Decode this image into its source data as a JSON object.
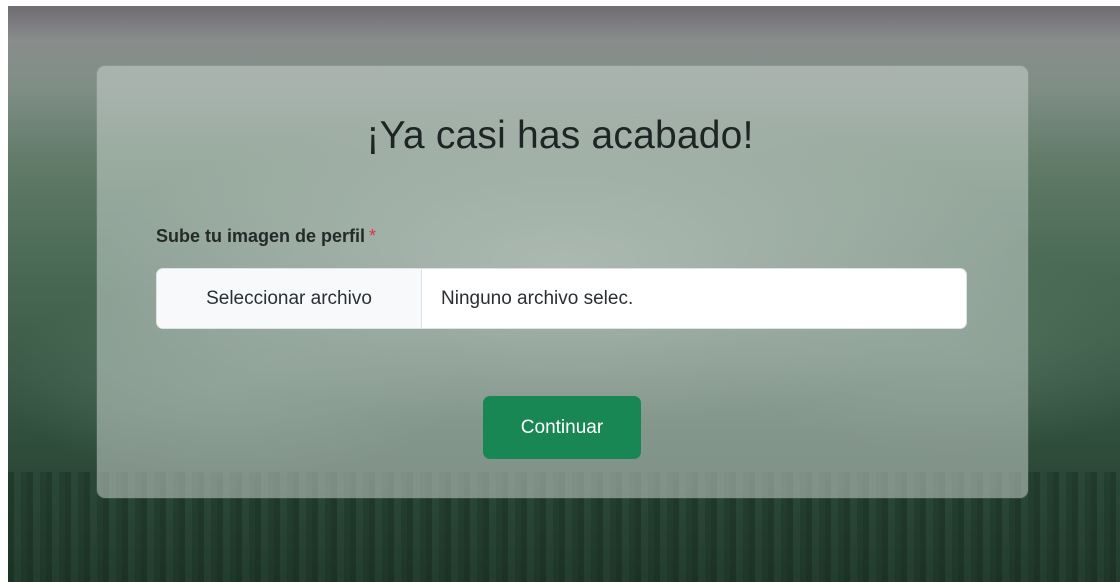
{
  "card": {
    "title": "¡Ya casi has acabado!"
  },
  "upload": {
    "label": "Sube tu imagen de perfil",
    "required_marker": "*",
    "button_label": "Seleccionar archivo",
    "status_text": "Ninguno archivo selec."
  },
  "actions": {
    "continue_label": "Continuar"
  },
  "colors": {
    "primary_button": "#198754",
    "required": "#dc3545"
  }
}
